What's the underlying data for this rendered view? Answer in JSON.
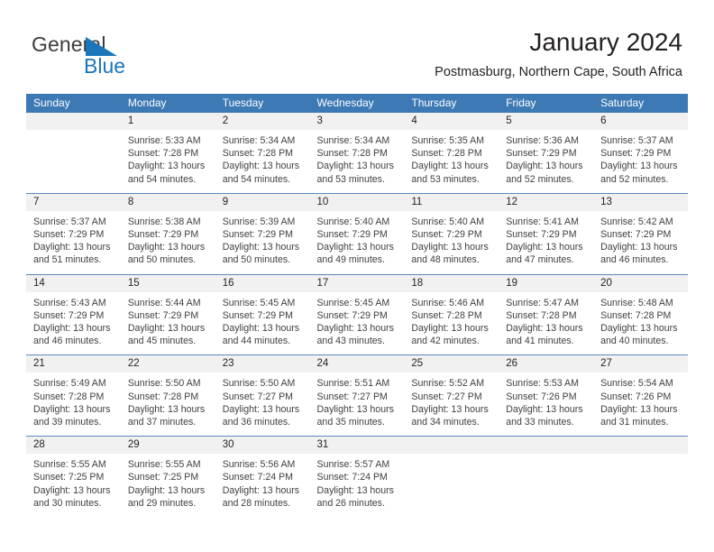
{
  "brand": {
    "name_part1": "General",
    "name_part2": "Blue",
    "flag_icon": "blue-triangle-flag-icon",
    "colors": {
      "general": "#3c3c3b",
      "blue": "#1b75bb"
    }
  },
  "header": {
    "title": "January 2024",
    "subtitle": "Postmasburg, Northern Cape, South Africa"
  },
  "colors": {
    "header_blue": "#3d79b5",
    "daynum_band": "#f1f1f1",
    "row_divider": "#5b89bb",
    "text": "#231f20",
    "body_text": "#404040"
  },
  "calendar": {
    "weekday_headers": [
      "Sunday",
      "Monday",
      "Tuesday",
      "Wednesday",
      "Thursday",
      "Friday",
      "Saturday"
    ],
    "weeks": [
      [
        {
          "day": "",
          "empty": true,
          "sunrise": "",
          "sunset": "",
          "daylight_line1": "",
          "daylight_line2": ""
        },
        {
          "day": "1",
          "empty": false,
          "sunrise": "Sunrise: 5:33 AM",
          "sunset": "Sunset: 7:28 PM",
          "daylight_line1": "Daylight: 13 hours",
          "daylight_line2": "and 54 minutes."
        },
        {
          "day": "2",
          "empty": false,
          "sunrise": "Sunrise: 5:34 AM",
          "sunset": "Sunset: 7:28 PM",
          "daylight_line1": "Daylight: 13 hours",
          "daylight_line2": "and 54 minutes."
        },
        {
          "day": "3",
          "empty": false,
          "sunrise": "Sunrise: 5:34 AM",
          "sunset": "Sunset: 7:28 PM",
          "daylight_line1": "Daylight: 13 hours",
          "daylight_line2": "and 53 minutes."
        },
        {
          "day": "4",
          "empty": false,
          "sunrise": "Sunrise: 5:35 AM",
          "sunset": "Sunset: 7:28 PM",
          "daylight_line1": "Daylight: 13 hours",
          "daylight_line2": "and 53 minutes."
        },
        {
          "day": "5",
          "empty": false,
          "sunrise": "Sunrise: 5:36 AM",
          "sunset": "Sunset: 7:29 PM",
          "daylight_line1": "Daylight: 13 hours",
          "daylight_line2": "and 52 minutes."
        },
        {
          "day": "6",
          "empty": false,
          "sunrise": "Sunrise: 5:37 AM",
          "sunset": "Sunset: 7:29 PM",
          "daylight_line1": "Daylight: 13 hours",
          "daylight_line2": "and 52 minutes."
        }
      ],
      [
        {
          "day": "7",
          "empty": false,
          "sunrise": "Sunrise: 5:37 AM",
          "sunset": "Sunset: 7:29 PM",
          "daylight_line1": "Daylight: 13 hours",
          "daylight_line2": "and 51 minutes."
        },
        {
          "day": "8",
          "empty": false,
          "sunrise": "Sunrise: 5:38 AM",
          "sunset": "Sunset: 7:29 PM",
          "daylight_line1": "Daylight: 13 hours",
          "daylight_line2": "and 50 minutes."
        },
        {
          "day": "9",
          "empty": false,
          "sunrise": "Sunrise: 5:39 AM",
          "sunset": "Sunset: 7:29 PM",
          "daylight_line1": "Daylight: 13 hours",
          "daylight_line2": "and 50 minutes."
        },
        {
          "day": "10",
          "empty": false,
          "sunrise": "Sunrise: 5:40 AM",
          "sunset": "Sunset: 7:29 PM",
          "daylight_line1": "Daylight: 13 hours",
          "daylight_line2": "and 49 minutes."
        },
        {
          "day": "11",
          "empty": false,
          "sunrise": "Sunrise: 5:40 AM",
          "sunset": "Sunset: 7:29 PM",
          "daylight_line1": "Daylight: 13 hours",
          "daylight_line2": "and 48 minutes."
        },
        {
          "day": "12",
          "empty": false,
          "sunrise": "Sunrise: 5:41 AM",
          "sunset": "Sunset: 7:29 PM",
          "daylight_line1": "Daylight: 13 hours",
          "daylight_line2": "and 47 minutes."
        },
        {
          "day": "13",
          "empty": false,
          "sunrise": "Sunrise: 5:42 AM",
          "sunset": "Sunset: 7:29 PM",
          "daylight_line1": "Daylight: 13 hours",
          "daylight_line2": "and 46 minutes."
        }
      ],
      [
        {
          "day": "14",
          "empty": false,
          "sunrise": "Sunrise: 5:43 AM",
          "sunset": "Sunset: 7:29 PM",
          "daylight_line1": "Daylight: 13 hours",
          "daylight_line2": "and 46 minutes."
        },
        {
          "day": "15",
          "empty": false,
          "sunrise": "Sunrise: 5:44 AM",
          "sunset": "Sunset: 7:29 PM",
          "daylight_line1": "Daylight: 13 hours",
          "daylight_line2": "and 45 minutes."
        },
        {
          "day": "16",
          "empty": false,
          "sunrise": "Sunrise: 5:45 AM",
          "sunset": "Sunset: 7:29 PM",
          "daylight_line1": "Daylight: 13 hours",
          "daylight_line2": "and 44 minutes."
        },
        {
          "day": "17",
          "empty": false,
          "sunrise": "Sunrise: 5:45 AM",
          "sunset": "Sunset: 7:29 PM",
          "daylight_line1": "Daylight: 13 hours",
          "daylight_line2": "and 43 minutes."
        },
        {
          "day": "18",
          "empty": false,
          "sunrise": "Sunrise: 5:46 AM",
          "sunset": "Sunset: 7:28 PM",
          "daylight_line1": "Daylight: 13 hours",
          "daylight_line2": "and 42 minutes."
        },
        {
          "day": "19",
          "empty": false,
          "sunrise": "Sunrise: 5:47 AM",
          "sunset": "Sunset: 7:28 PM",
          "daylight_line1": "Daylight: 13 hours",
          "daylight_line2": "and 41 minutes."
        },
        {
          "day": "20",
          "empty": false,
          "sunrise": "Sunrise: 5:48 AM",
          "sunset": "Sunset: 7:28 PM",
          "daylight_line1": "Daylight: 13 hours",
          "daylight_line2": "and 40 minutes."
        }
      ],
      [
        {
          "day": "21",
          "empty": false,
          "sunrise": "Sunrise: 5:49 AM",
          "sunset": "Sunset: 7:28 PM",
          "daylight_line1": "Daylight: 13 hours",
          "daylight_line2": "and 39 minutes."
        },
        {
          "day": "22",
          "empty": false,
          "sunrise": "Sunrise: 5:50 AM",
          "sunset": "Sunset: 7:28 PM",
          "daylight_line1": "Daylight: 13 hours",
          "daylight_line2": "and 37 minutes."
        },
        {
          "day": "23",
          "empty": false,
          "sunrise": "Sunrise: 5:50 AM",
          "sunset": "Sunset: 7:27 PM",
          "daylight_line1": "Daylight: 13 hours",
          "daylight_line2": "and 36 minutes."
        },
        {
          "day": "24",
          "empty": false,
          "sunrise": "Sunrise: 5:51 AM",
          "sunset": "Sunset: 7:27 PM",
          "daylight_line1": "Daylight: 13 hours",
          "daylight_line2": "and 35 minutes."
        },
        {
          "day": "25",
          "empty": false,
          "sunrise": "Sunrise: 5:52 AM",
          "sunset": "Sunset: 7:27 PM",
          "daylight_line1": "Daylight: 13 hours",
          "daylight_line2": "and 34 minutes."
        },
        {
          "day": "26",
          "empty": false,
          "sunrise": "Sunrise: 5:53 AM",
          "sunset": "Sunset: 7:26 PM",
          "daylight_line1": "Daylight: 13 hours",
          "daylight_line2": "and 33 minutes."
        },
        {
          "day": "27",
          "empty": false,
          "sunrise": "Sunrise: 5:54 AM",
          "sunset": "Sunset: 7:26 PM",
          "daylight_line1": "Daylight: 13 hours",
          "daylight_line2": "and 31 minutes."
        }
      ],
      [
        {
          "day": "28",
          "empty": false,
          "sunrise": "Sunrise: 5:55 AM",
          "sunset": "Sunset: 7:25 PM",
          "daylight_line1": "Daylight: 13 hours",
          "daylight_line2": "and 30 minutes."
        },
        {
          "day": "29",
          "empty": false,
          "sunrise": "Sunrise: 5:55 AM",
          "sunset": "Sunset: 7:25 PM",
          "daylight_line1": "Daylight: 13 hours",
          "daylight_line2": "and 29 minutes."
        },
        {
          "day": "30",
          "empty": false,
          "sunrise": "Sunrise: 5:56 AM",
          "sunset": "Sunset: 7:24 PM",
          "daylight_line1": "Daylight: 13 hours",
          "daylight_line2": "and 28 minutes."
        },
        {
          "day": "31",
          "empty": false,
          "sunrise": "Sunrise: 5:57 AM",
          "sunset": "Sunset: 7:24 PM",
          "daylight_line1": "Daylight: 13 hours",
          "daylight_line2": "and 26 minutes."
        },
        {
          "day": "",
          "empty": true,
          "sunrise": "",
          "sunset": "",
          "daylight_line1": "",
          "daylight_line2": ""
        },
        {
          "day": "",
          "empty": true,
          "sunrise": "",
          "sunset": "",
          "daylight_line1": "",
          "daylight_line2": ""
        },
        {
          "day": "",
          "empty": true,
          "sunrise": "",
          "sunset": "",
          "daylight_line1": "",
          "daylight_line2": ""
        }
      ]
    ]
  }
}
